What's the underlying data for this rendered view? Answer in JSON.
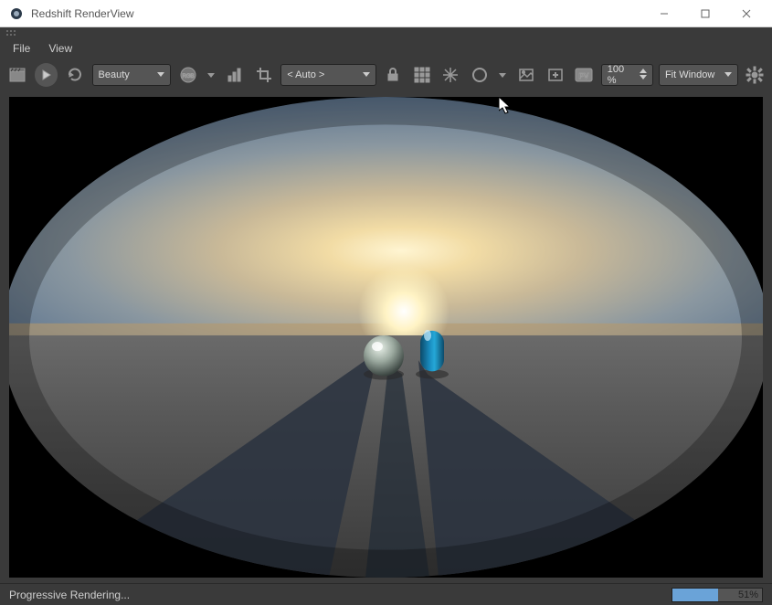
{
  "window": {
    "title": "Redshift RenderView"
  },
  "menu": {
    "file": "File",
    "view": "View"
  },
  "toolbar": {
    "channel_dropdown": "Beauty",
    "auto_dropdown": "< Auto >",
    "zoom_value": "100 %",
    "fit_dropdown": "Fit Window"
  },
  "status": {
    "text": "Progressive Rendering...",
    "progress_percent": 51,
    "progress_label": "51%"
  },
  "colors": {
    "panel_bg": "#3a3a3a",
    "progress_fill": "#6aa3d8"
  }
}
